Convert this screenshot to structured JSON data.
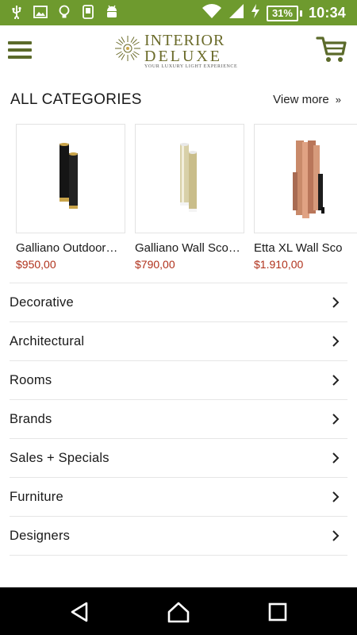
{
  "status_bar": {
    "icons": [
      "usb-icon",
      "image-icon",
      "bulb-icon",
      "app-icon",
      "android-icon"
    ],
    "battery_percent": "31%",
    "time": "10:34"
  },
  "header": {
    "logo_line1": "INTERIOR",
    "logo_line2": "DELUXE",
    "logo_tagline": "YOUR LUXURY LIGHT EXPERIENCE"
  },
  "section": {
    "title": "ALL CATEGORIES",
    "view_more": "View more",
    "view_more_icon": "double-chevron-right-icon"
  },
  "products": [
    {
      "name": "Galliano Outdoor…",
      "price": "$950,00"
    },
    {
      "name": "Galliano Wall Sco…",
      "price": "$790,00"
    },
    {
      "name": "Etta XL Wall Sco",
      "price": "$1.910,00"
    }
  ],
  "categories": [
    {
      "label": "Decorative"
    },
    {
      "label": "Architectural"
    },
    {
      "label": "Rooms"
    },
    {
      "label": "Brands"
    },
    {
      "label": "Sales + Specials"
    },
    {
      "label": "Furniture"
    },
    {
      "label": "Designers"
    }
  ],
  "colors": {
    "status_bar": "#6e9a2e",
    "brand_olive": "#5b6a2a",
    "price_red": "#b0311b"
  }
}
